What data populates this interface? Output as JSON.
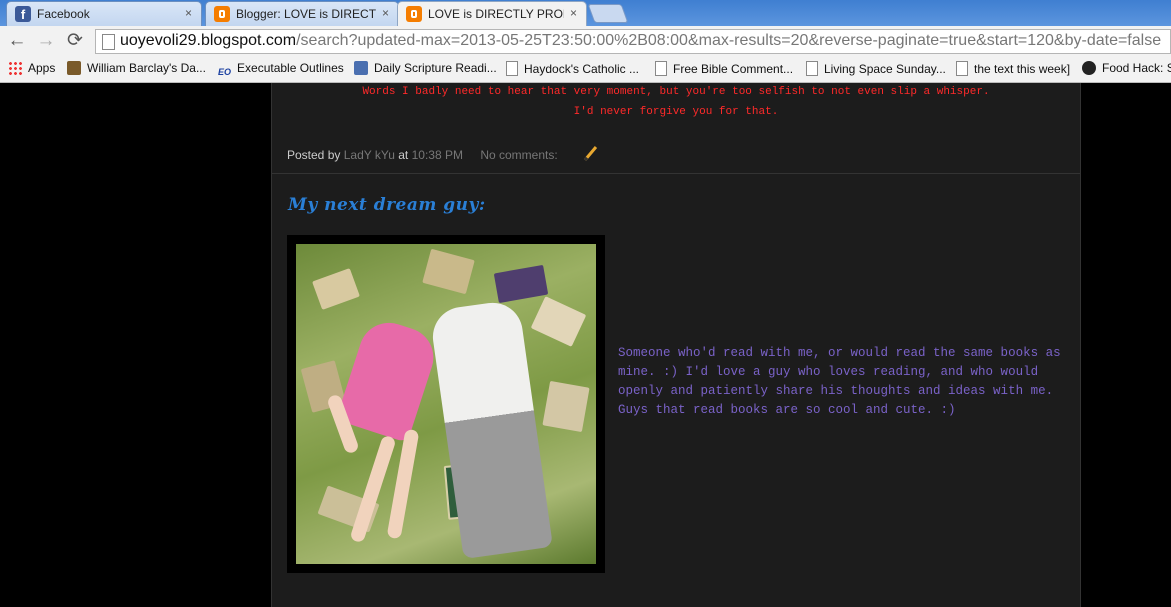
{
  "tabs": [
    {
      "title": "Facebook",
      "icon": "facebook-icon",
      "active": false
    },
    {
      "title": "Blogger: LOVE is DIRECTLY",
      "icon": "blogger-icon",
      "active": false
    },
    {
      "title": "LOVE is DIRECTLY PROPO",
      "icon": "blogger-icon",
      "active": true
    }
  ],
  "tab_close_glyph": "×",
  "toolbar": {
    "back_glyph": "←",
    "forward_glyph": "→",
    "reload_glyph": "⟳",
    "url_host": "uoyevoli29.blogspot.com",
    "url_path": "/search?updated-max=2013-05-25T23:50:00%2B08:00&max-results=20&reverse-paginate=true&start=120&by-date=false"
  },
  "bookmarks": [
    {
      "label": "Apps",
      "icon": "apps-icon"
    },
    {
      "label": "William Barclay's Da...",
      "icon": "book-icon"
    },
    {
      "label": "Executable Outlines",
      "icon": "eo-icon"
    },
    {
      "label": "Daily Scripture Readi...",
      "icon": "scripture-icon"
    },
    {
      "label": "Haydock's Catholic ...",
      "icon": "page-icon"
    },
    {
      "label": "Free Bible Comment...",
      "icon": "page-icon"
    },
    {
      "label": "Living Space Sunday...",
      "icon": "page-icon"
    },
    {
      "label": "the text this week]",
      "icon": "page-icon"
    },
    {
      "label": "Food Hack: S",
      "icon": "film-icon"
    }
  ],
  "previous_post": {
    "line1": "Words I badly need to hear that very moment, but you're too selfish to not even slip a whisper.",
    "line2": "I'd never forgive you for that.",
    "posted_by_label": "Posted by",
    "author": "LadY kYu",
    "at_label": "at",
    "time": "10:38 PM",
    "comments": "No comments:"
  },
  "post": {
    "title": "My next dream guy:",
    "body": "Someone who'd read with me, or would read the same books as mine. :) I'd love a guy who loves reading, and who would openly and patiently share his thoughts and ideas with me. Guys that read books are so cool and cute. :)"
  },
  "colors": {
    "accent_red": "#ff2a2a",
    "title_blue": "#2a7fd6",
    "body_purple": "#7a62c8"
  }
}
